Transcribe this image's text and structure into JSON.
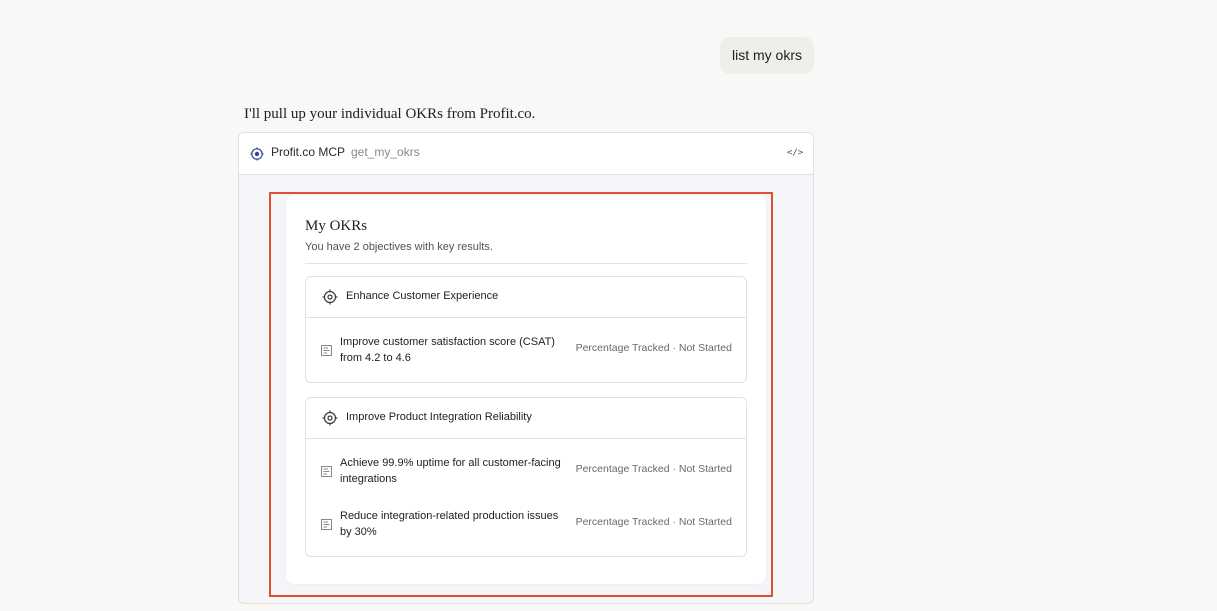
{
  "conversation": {
    "user_message": "list my okrs",
    "assistant_message": "I'll pull up your individual OKRs from Profit.co."
  },
  "tool_call": {
    "server_name": "Profit.co MCP",
    "method_name": "get_my_okrs",
    "code_toggle_icon": "code-brackets-icon"
  },
  "okr_widget": {
    "title": "My OKRs",
    "subtitle": "You have 2 objectives with key results.",
    "objectives": [
      {
        "title": "Enhance Customer Experience",
        "icon": "target-icon",
        "key_results": [
          {
            "text": "Improve customer satisfaction score (CSAT) from 4.2 to 4.6",
            "meta": "Percentage Tracked · Not Started",
            "icon": "key-result-icon"
          }
        ]
      },
      {
        "title": "Improve Product Integration Reliability",
        "icon": "target-icon",
        "key_results": [
          {
            "text": "Achieve 99.9% uptime for all customer-facing integrations",
            "meta": "Percentage Tracked · Not Started",
            "icon": "key-result-icon"
          },
          {
            "text": "Reduce integration-related production issues by 30%",
            "meta": "Percentage Tracked · Not Started",
            "icon": "key-result-icon"
          }
        ]
      }
    ]
  },
  "colors": {
    "highlight_border": "#e0502f",
    "page_background": "#f9f8f6",
    "user_bubble": "#efeeea"
  }
}
